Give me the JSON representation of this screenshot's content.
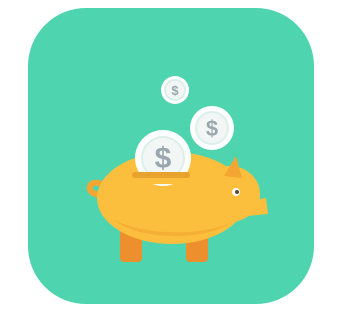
{
  "app_icon": {
    "name": "piggy-bank-savings",
    "icon": "piggy-bank-icon",
    "colors": {
      "background": "#4ED4AE",
      "pig_body": "#FCBF3D",
      "pig_shade": "#F3A632",
      "pig_legs": "#EE8F2D",
      "coin_fill": "#FFFFFF",
      "coin_ring": "#DCEFEA",
      "coin_symbol": "#9BA7AE"
    },
    "coins": [
      {
        "symbol": "$",
        "icon": "dollar-coin-icon"
      },
      {
        "symbol": "$",
        "icon": "dollar-coin-icon"
      },
      {
        "symbol": "$",
        "icon": "dollar-coin-icon"
      }
    ]
  }
}
